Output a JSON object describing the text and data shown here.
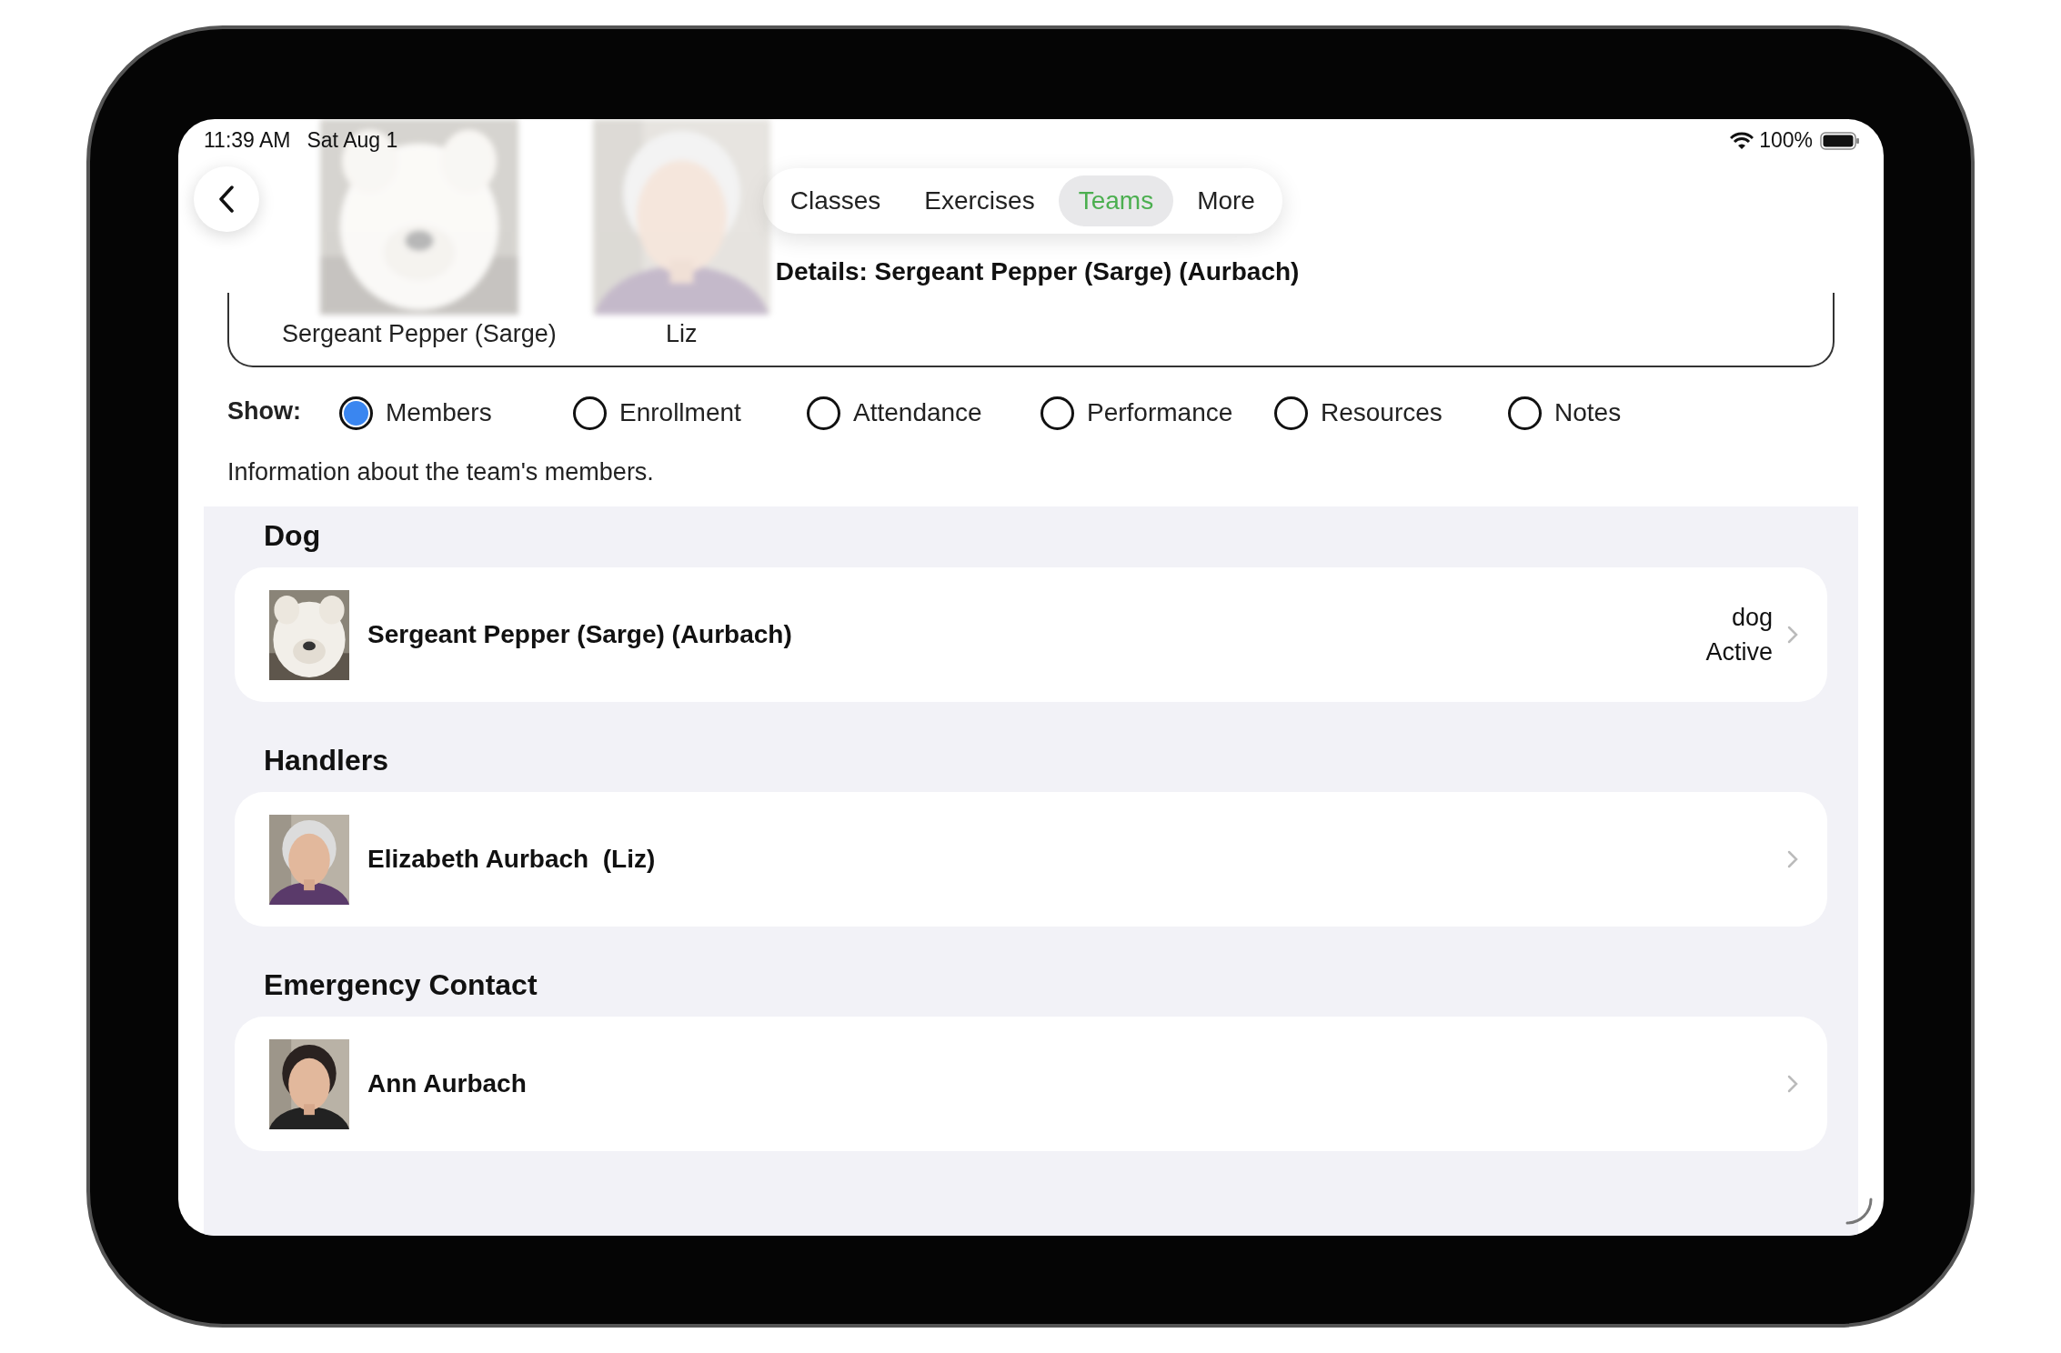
{
  "status_bar": {
    "time": "11:39 AM",
    "date": "Sat Aug 1",
    "battery": "100%"
  },
  "header": {
    "photos": [
      {
        "caption": "Sergeant Pepper (Sarge)"
      },
      {
        "caption": "Liz"
      }
    ],
    "tabs": [
      {
        "label": "Classes",
        "selected": false
      },
      {
        "label": "Exercises",
        "selected": false
      },
      {
        "label": "Teams",
        "selected": true
      },
      {
        "label": "More",
        "selected": false
      }
    ],
    "details": "Details: Sergeant Pepper (Sarge) (Aurbach)"
  },
  "show": {
    "label": "Show:",
    "options": [
      {
        "label": "Members",
        "selected": true
      },
      {
        "label": "Enrollment",
        "selected": false
      },
      {
        "label": "Attendance",
        "selected": false
      },
      {
        "label": "Performance",
        "selected": false
      },
      {
        "label": "Resources",
        "selected": false
      },
      {
        "label": "Notes",
        "selected": false
      }
    ]
  },
  "description": "Information about the team's members.",
  "sections": [
    {
      "title": "Dog",
      "rows": [
        {
          "name": "Sergeant Pepper (Sarge) (Aurbach)",
          "detail_lines": [
            "dog",
            "Active"
          ]
        }
      ]
    },
    {
      "title": "Handlers",
      "rows": [
        {
          "name": "Elizabeth Aurbach  (Liz)"
        }
      ]
    },
    {
      "title": "Emergency Contact",
      "rows": [
        {
          "name": "Ann Aurbach"
        }
      ]
    }
  ]
}
